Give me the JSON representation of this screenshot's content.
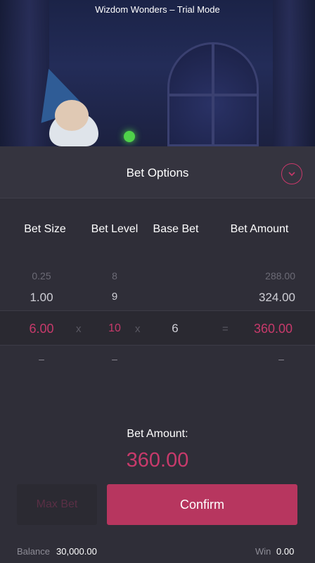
{
  "game": {
    "title": "Wizdom Wonders – Trial Mode"
  },
  "panel": {
    "title": "Bet Options",
    "collapse_icon": "chevron-down-icon",
    "columns": {
      "bet_size": "Bet Size",
      "bet_level": "Bet Level",
      "base_bet": "Base Bet",
      "bet_amount": "Bet Amount"
    },
    "rows_above": [
      {
        "bet_size": "0.25",
        "bet_level": "8",
        "bet_amount": "288.00"
      },
      {
        "bet_size": "1.00",
        "bet_level": "9",
        "bet_amount": "324.00"
      }
    ],
    "selected": {
      "bet_size": "6.00",
      "times1": "x",
      "bet_level": "10",
      "times2": "x",
      "base_bet": "6",
      "equals": "=",
      "bet_amount": "360.00"
    },
    "rows_below": {
      "bet_size": "–",
      "bet_level": "–",
      "bet_amount": "–"
    },
    "summary_label": "Bet Amount:",
    "summary_value": "360.00",
    "max_bet_label": "Max Bet",
    "confirm_label": "Confirm"
  },
  "footer": {
    "balance_label": "Balance",
    "balance_value": "30,000.00",
    "win_label": "Win",
    "win_value": "0.00"
  },
  "colors": {
    "accent": "#c83a6b",
    "panel_bg": "#2f2e38",
    "header_bg": "#35343f"
  }
}
